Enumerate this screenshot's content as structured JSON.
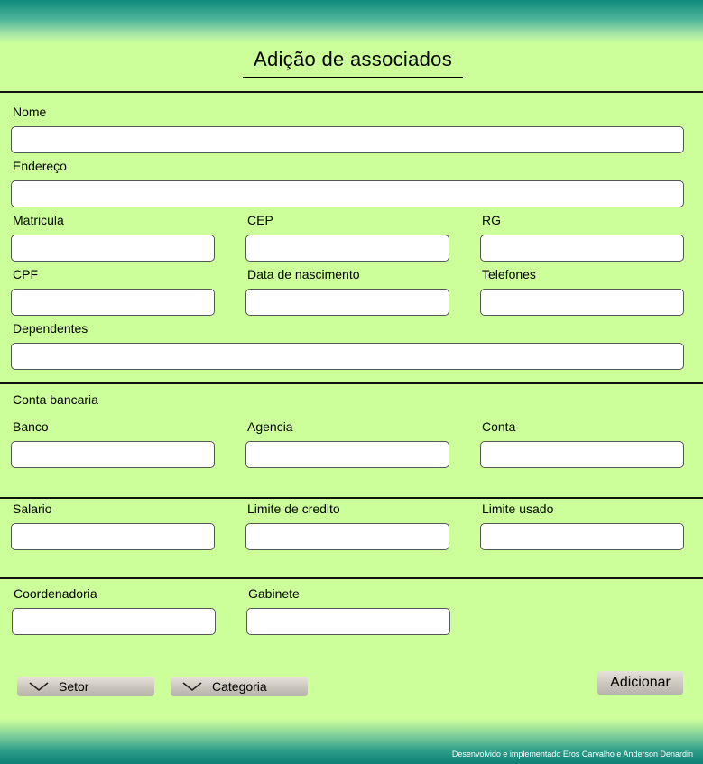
{
  "page": {
    "title": "Adição de associados",
    "footer_credit": "Desenvolvido e implementado Eros Carvalho e Anderson Denardin"
  },
  "personal": {
    "nome_label": "Nome",
    "endereco_label": "Endereço",
    "matricula_label": "Matricula",
    "cep_label": "CEP",
    "rg_label": "RG",
    "cpf_label": "CPF",
    "nascimento_label": "Data de nascimento",
    "telefones_label": "Telefones",
    "dependentes_label": "Dependentes"
  },
  "bank": {
    "section_label": "Conta bancaria",
    "banco_label": "Banco",
    "agencia_label": "Agencia",
    "conta_label": "Conta"
  },
  "credit": {
    "salario_label": "Salario",
    "limite_credito_label": "Limite de credito",
    "limite_usado_label": "Limite usado"
  },
  "org": {
    "coordenadoria_label": "Coordenadoria",
    "gabinete_label": "Gabinete"
  },
  "actions": {
    "setor_label": "Setor",
    "categoria_label": "Categoria",
    "add_label": "Adicionar"
  },
  "icons": {
    "dropdown": "chevron-down-icon"
  },
  "colors": {
    "background": "#ccff99",
    "header_teal": "#0f8a7c",
    "button_grey": "#c9c5bb"
  }
}
